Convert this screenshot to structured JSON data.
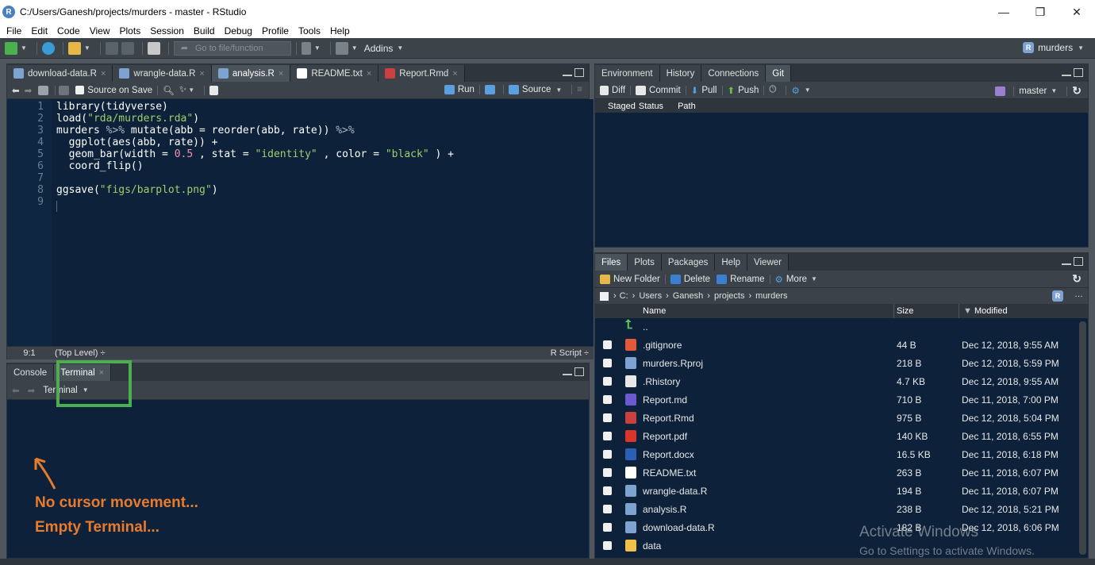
{
  "window": {
    "title": "C:/Users/Ganesh/projects/murders - master - RStudio",
    "controls": [
      "—",
      "❐",
      "✕"
    ]
  },
  "menu": [
    "File",
    "Edit",
    "Code",
    "View",
    "Plots",
    "Session",
    "Build",
    "Debug",
    "Profile",
    "Tools",
    "Help"
  ],
  "toolbar": {
    "goto_placeholder": "Go to file/function",
    "addins_label": "Addins",
    "project_label": "murders"
  },
  "editor": {
    "tabs": [
      {
        "label": "download-data.R",
        "icon_color": "#7ea3d0"
      },
      {
        "label": "wrangle-data.R",
        "icon_color": "#7ea3d0"
      },
      {
        "label": "analysis.R",
        "icon_color": "#7ea3d0"
      },
      {
        "label": "README.txt",
        "icon_color": "#ffffff"
      },
      {
        "label": "Report.Rmd",
        "icon_color": "#c94040"
      }
    ],
    "active_tab": "analysis.R",
    "source_on_save_label": "Source on Save",
    "run_label": "Run",
    "source_label": "Source",
    "lines": [
      {
        "n": "1",
        "text": "library(tidyverse)"
      },
      {
        "n": "2",
        "text": "load(\"rda/murders.rda\")"
      },
      {
        "n": "3",
        "text": "murders %>% mutate(abb = reorder(abb, rate)) %>%"
      },
      {
        "n": "4",
        "text": "  ggplot(aes(abb, rate)) +"
      },
      {
        "n": "5",
        "text": "  geom_bar(width = 0.5 , stat = \"identity\" , color = \"black\" ) +"
      },
      {
        "n": "6",
        "text": "  coord_flip()"
      },
      {
        "n": "7",
        "text": ""
      },
      {
        "n": "8",
        "text": "ggsave(\"figs/barplot.png\")"
      },
      {
        "n": "9",
        "text": ""
      }
    ],
    "status": {
      "position": "9:1",
      "scope": "(Top Level) ÷",
      "filetype": "R Script ÷"
    }
  },
  "console": {
    "tabs": [
      "Console",
      "Terminal"
    ],
    "active_tab": "Terminal",
    "terminal_selector": "Terminal",
    "annotation_line1": "No cursor movement...",
    "annotation_line2": "Empty Terminal..."
  },
  "git_pane": {
    "tabs": [
      "Environment",
      "History",
      "Connections",
      "Git"
    ],
    "active_tab": "Git",
    "toolbar": {
      "diff": "Diff",
      "commit": "Commit",
      "pull": "Pull",
      "push": "Push",
      "branch": "master"
    },
    "columns": [
      "Staged",
      "Status",
      "Path"
    ]
  },
  "files_pane": {
    "tabs": [
      "Files",
      "Plots",
      "Packages",
      "Help",
      "Viewer"
    ],
    "active_tab": "Files",
    "toolbar": {
      "new_folder": "New Folder",
      "delete": "Delete",
      "rename": "Rename",
      "more": "More"
    },
    "breadcrumb": [
      "C:",
      "Users",
      "Ganesh",
      "projects",
      "murders"
    ],
    "columns": {
      "name": "Name",
      "size": "Size",
      "modified": "Modified"
    },
    "parent_label": "..",
    "files": [
      {
        "name": ".gitignore",
        "size": "44 B",
        "modified": "Dec 12, 2018, 9:55 AM",
        "icon": "gitignore-icon",
        "color": "#e05a3a"
      },
      {
        "name": "murders.Rproj",
        "size": "218 B",
        "modified": "Dec 12, 2018, 5:59 PM",
        "icon": "rproj-icon",
        "color": "#7ea3d0"
      },
      {
        "name": ".Rhistory",
        "size": "4.7 KB",
        "modified": "Dec 12, 2018, 9:55 AM",
        "icon": "rhistory-icon",
        "color": "#e8e8e8"
      },
      {
        "name": "Report.md",
        "size": "710 B",
        "modified": "Dec 11, 2018, 7:00 PM",
        "icon": "markdown-icon",
        "color": "#6a5acd"
      },
      {
        "name": "Report.Rmd",
        "size": "975 B",
        "modified": "Dec 12, 2018, 5:04 PM",
        "icon": "rmarkdown-icon",
        "color": "#c94040"
      },
      {
        "name": "Report.pdf",
        "size": "140 KB",
        "modified": "Dec 11, 2018, 6:55 PM",
        "icon": "pdf-icon",
        "color": "#d9362b"
      },
      {
        "name": "Report.docx",
        "size": "16.5 KB",
        "modified": "Dec 11, 2018, 6:18 PM",
        "icon": "word-icon",
        "color": "#2b5fb4"
      },
      {
        "name": "README.txt",
        "size": "263 B",
        "modified": "Dec 11, 2018, 6:07 PM",
        "icon": "text-file-icon",
        "color": "#ffffff"
      },
      {
        "name": "wrangle-data.R",
        "size": "194 B",
        "modified": "Dec 11, 2018, 6:07 PM",
        "icon": "r-script-icon",
        "color": "#7ea3d0"
      },
      {
        "name": "analysis.R",
        "size": "238 B",
        "modified": "Dec 12, 2018, 5:21 PM",
        "icon": "r-script-icon",
        "color": "#7ea3d0"
      },
      {
        "name": "download-data.R",
        "size": "182 B",
        "modified": "Dec 12, 2018, 6:06 PM",
        "icon": "r-script-icon",
        "color": "#7ea3d0"
      },
      {
        "name": "data",
        "size": "",
        "modified": "",
        "icon": "folder-icon",
        "color": "#f0c04a"
      }
    ]
  },
  "watermark": {
    "line1": "Activate Windows",
    "line2": "Go to Settings to activate Windows."
  },
  "colors": {
    "accent_annotation": "#e87b2c",
    "highlight_box": "#4cae4c",
    "editor_bg": "#0d223a"
  }
}
